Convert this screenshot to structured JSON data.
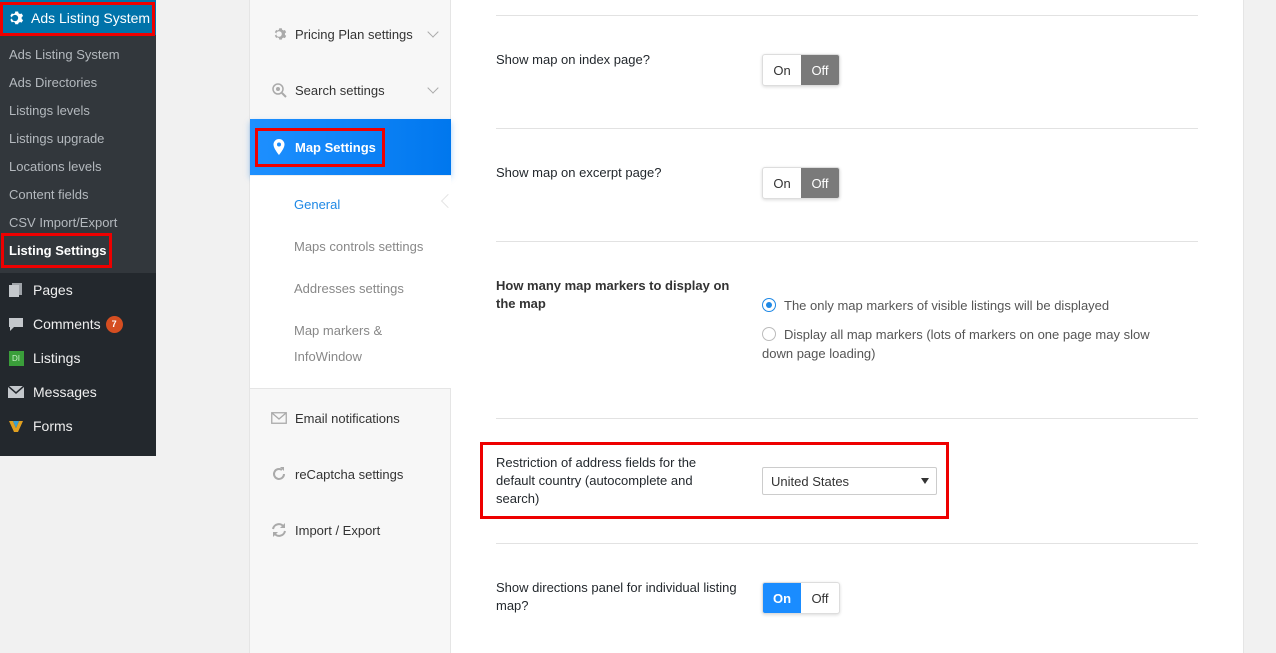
{
  "wp_sidebar": {
    "top_item": "Ads Listing System",
    "submenu": [
      "Ads Listing System",
      "Ads Directories",
      "Listings levels",
      "Listings upgrade",
      "Locations levels",
      "Content fields",
      "CSV Import/Export",
      "Listing Settings"
    ],
    "main_items": [
      {
        "label": "Pages",
        "icon": "pages-icon"
      },
      {
        "label": "Comments",
        "icon": "comments-icon",
        "badge": "7"
      },
      {
        "label": "Listings",
        "icon": "listings-icon",
        "icon_text": "DI"
      },
      {
        "label": "Messages",
        "icon": "messages-icon"
      },
      {
        "label": "Forms",
        "icon": "forms-icon"
      }
    ]
  },
  "tab_nav": {
    "pricing": "Pricing Plan settings",
    "search": "Search settings",
    "map": "Map Settings",
    "sub_tabs": [
      "General",
      "Maps controls settings",
      "Addresses settings",
      "Map markers & InfoWindow"
    ],
    "email": "Email notifications",
    "recaptcha": "reCaptcha settings",
    "import_export": "Import / Export"
  },
  "settings": {
    "show_map_index": {
      "label": "Show map on index page?",
      "on": "On",
      "off": "Off",
      "value": "Off"
    },
    "show_map_excerpt": {
      "label": "Show map on excerpt page?",
      "on": "On",
      "off": "Off",
      "value": "Off"
    },
    "markers": {
      "label": "How many map markers to display on the map",
      "option1": "The only map markers of visible listings will be displayed",
      "option2": "Display all map markers (lots of markers on one page may slow down page loading)",
      "selected": 1
    },
    "restriction": {
      "label": "Restriction of address fields for the default country (autocomplete and search)",
      "value": "United States"
    },
    "directions": {
      "label": "Show directions panel for individual listing map?",
      "on": "On",
      "off": "Off",
      "value": "On"
    }
  },
  "colors": {
    "wp_admin_blue": "#0073aa",
    "active_tab_blue": "#1e90ff",
    "highlight_red": "#e00000",
    "toggle_off_gray": "#7a7a7a"
  }
}
